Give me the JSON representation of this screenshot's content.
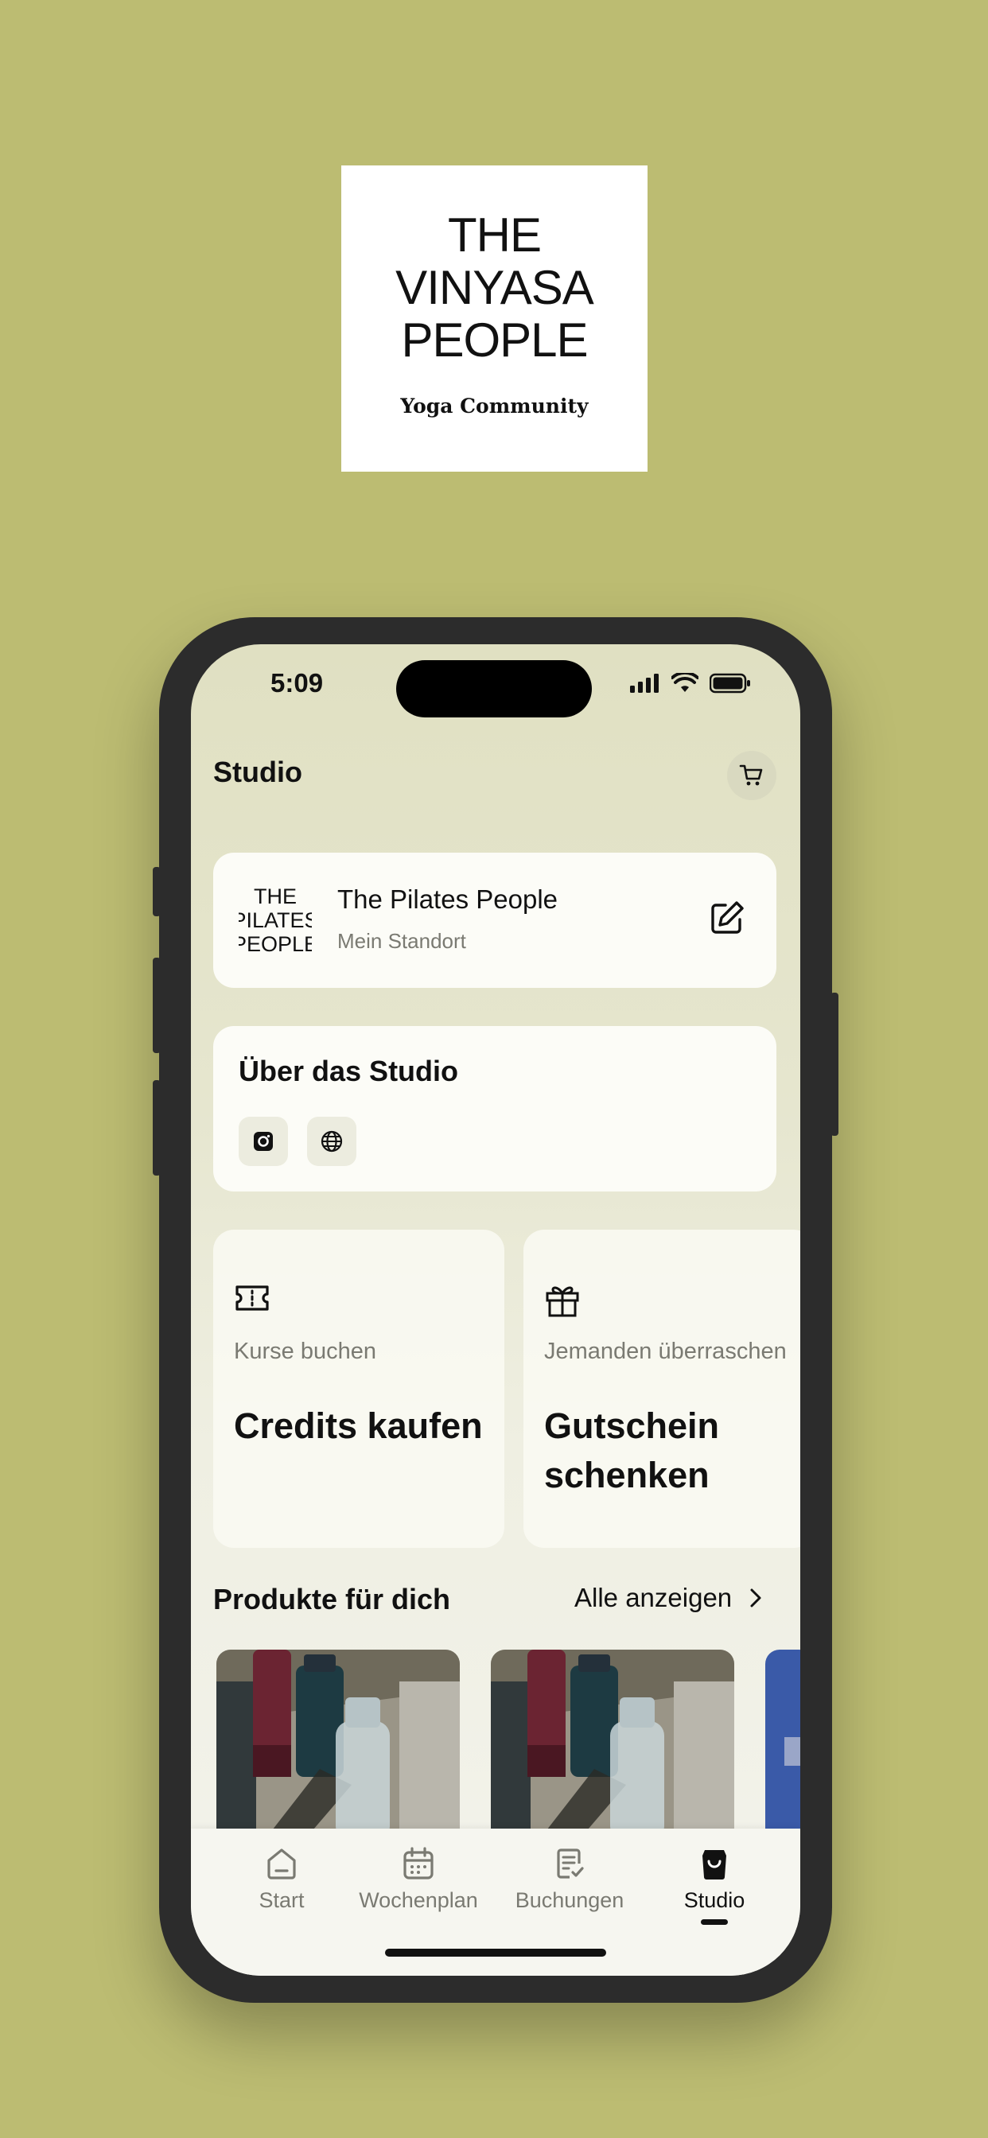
{
  "logo": {
    "lines": [
      "THE",
      "VINYASA",
      "PEOPLE"
    ],
    "subtitle": "Yoga Community"
  },
  "status_bar": {
    "time": "5:09"
  },
  "header": {
    "title": "Studio"
  },
  "location": {
    "logo_lines": [
      "THE",
      "PILATES",
      "PEOPLE"
    ],
    "name": "The Pilates People",
    "subtitle": "Mein Standort"
  },
  "about": {
    "title": "Über das Studio"
  },
  "tiles": [
    {
      "kicker": "Kurse buchen",
      "title": "Credits kaufen",
      "icon": "ticket-icon"
    },
    {
      "kicker": "Jemanden überraschen",
      "title": "Gutschein schenken",
      "icon": "gift-icon"
    }
  ],
  "products": {
    "title": "Produkte für dich",
    "show_all": "Alle anzeigen"
  },
  "tabbar": {
    "items": [
      {
        "label": "Start",
        "icon": "home-icon"
      },
      {
        "label": "Wochenplan",
        "icon": "calendar-icon"
      },
      {
        "label": "Buchungen",
        "icon": "bookings-icon"
      },
      {
        "label": "Studio",
        "icon": "shopping-bag-icon",
        "active": true
      }
    ]
  },
  "colors": {
    "background": "#bcbc72",
    "phone_frame": "#2c2c2c",
    "card": "#fcfcf7"
  }
}
